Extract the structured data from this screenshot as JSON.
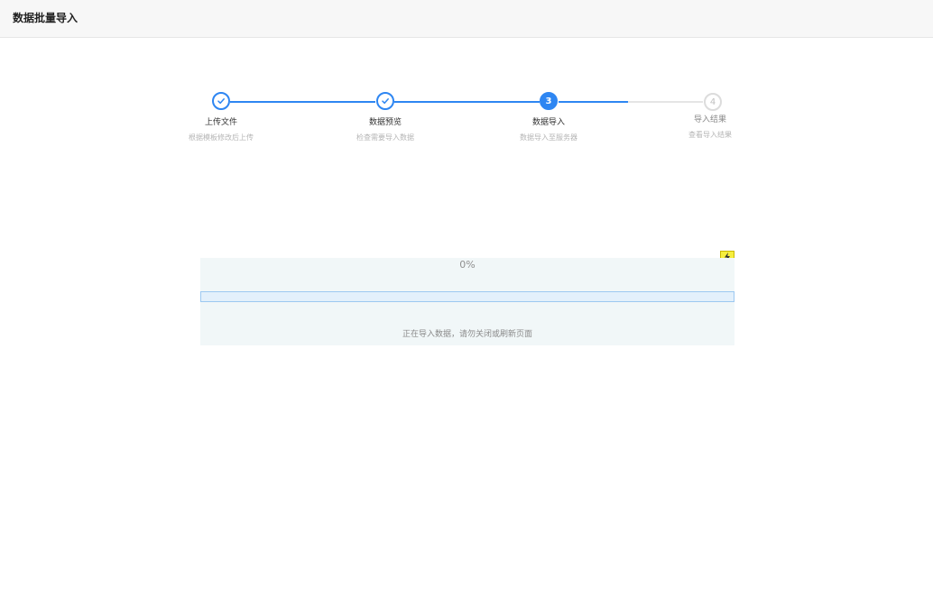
{
  "header": {
    "title": "数据批量导入"
  },
  "steps": [
    {
      "title": "上传文件",
      "description": "根据模板修改后上传",
      "status": "finished"
    },
    {
      "title": "数据预览",
      "description": "检查需要导入数据",
      "status": "finished"
    },
    {
      "number": "3",
      "title": "数据导入",
      "description": "数据导入至服务器",
      "status": "active"
    },
    {
      "number": "4",
      "title": "导入结果",
      "description": "查看导入结果",
      "status": "waiting"
    }
  ],
  "import": {
    "progress_percent": 0,
    "progress_text": "0%",
    "status_text": "正在导入数据，请勿关闭或刷新页面"
  },
  "colors": {
    "primary": "#2e86f2",
    "panel_bg": "#f1f7f8",
    "pending": "#dcdcdc"
  },
  "icons": {
    "step_finished": "check-icon",
    "corner_badge": "lightning-bolt-icon"
  }
}
